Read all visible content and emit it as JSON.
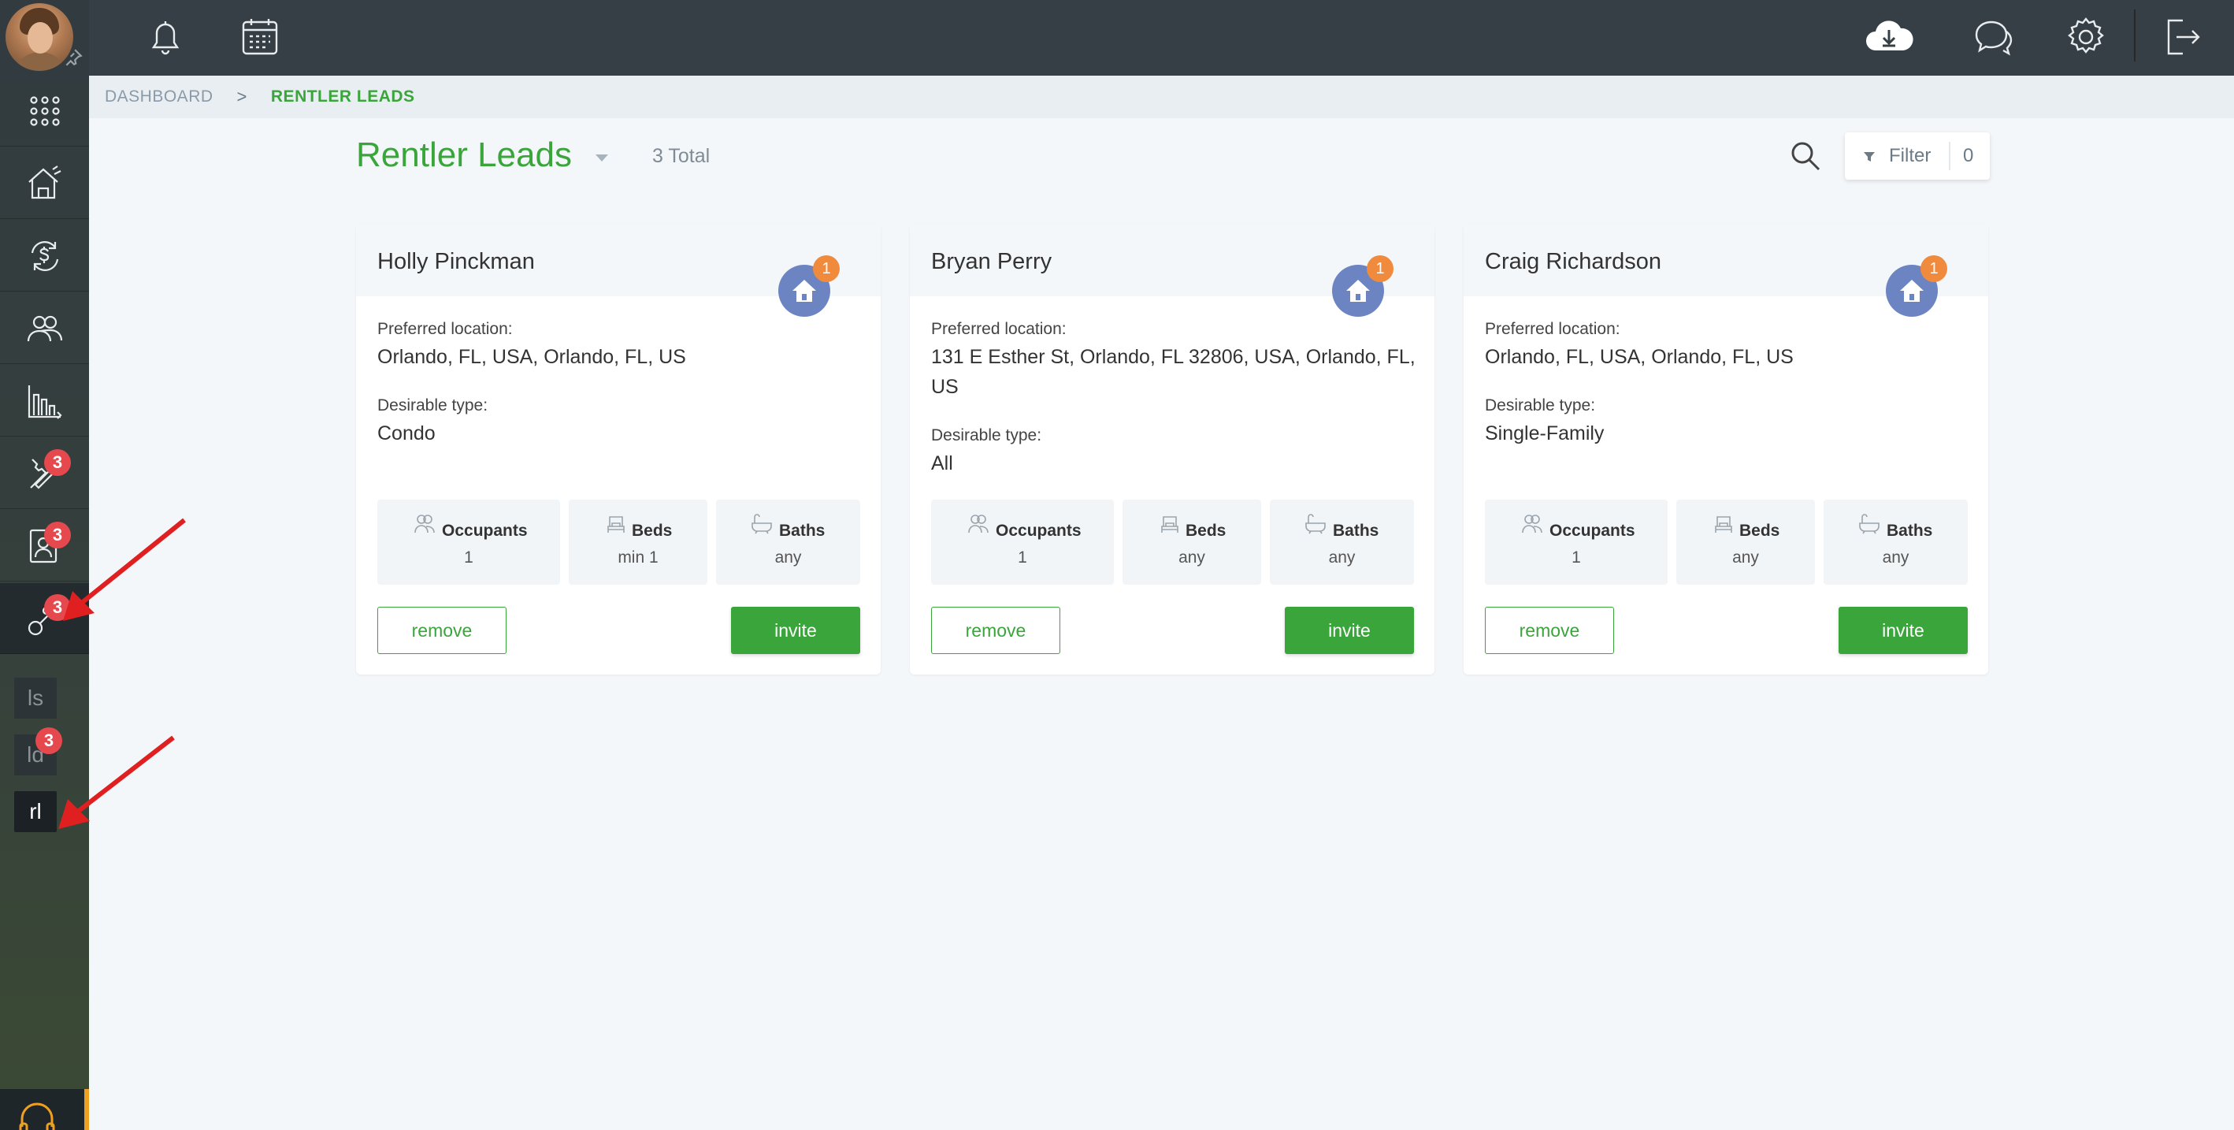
{
  "sidebar": {
    "badges": {
      "tools": "3",
      "contacts": "3",
      "leads": "3",
      "ld": "3"
    },
    "sub_items": [
      "ls",
      "ld",
      "rl"
    ]
  },
  "breadcrumb": {
    "root": "DASHBOARD",
    "separator": ">",
    "current": "RENTLER LEADS"
  },
  "header": {
    "title": "Rentler Leads",
    "total": "3 Total"
  },
  "filter": {
    "label": "Filter",
    "count": "0"
  },
  "labels": {
    "preferred_location": "Preferred location:",
    "desirable_type": "Desirable type:",
    "occupants": "Occupants",
    "beds": "Beds",
    "baths": "Baths",
    "remove": "remove",
    "invite": "invite"
  },
  "leads": [
    {
      "name": "Holly Pinckman",
      "home_count": "1",
      "location": "Orlando, FL, USA, Orlando, FL, US",
      "type": "Condo",
      "occupants": "1",
      "beds": "min 1",
      "baths": "any"
    },
    {
      "name": "Bryan Perry",
      "home_count": "1",
      "location": "131 E Esther St, Orlando, FL 32806, USA, Orlando, FL, US",
      "type": "All",
      "occupants": "1",
      "beds": "any",
      "baths": "any"
    },
    {
      "name": "Craig Richardson",
      "home_count": "1",
      "location": "Orlando, FL, USA, Orlando, FL, US",
      "type": "Single-Family",
      "occupants": "1",
      "beds": "any",
      "baths": "any"
    }
  ],
  "colors": {
    "accent": "#3aa53a",
    "sidebar": "#323b40",
    "topbar": "#353f45",
    "badge": "#e5484d",
    "home_icon": "#6d84c3",
    "home_badge": "#f08a3c"
  }
}
